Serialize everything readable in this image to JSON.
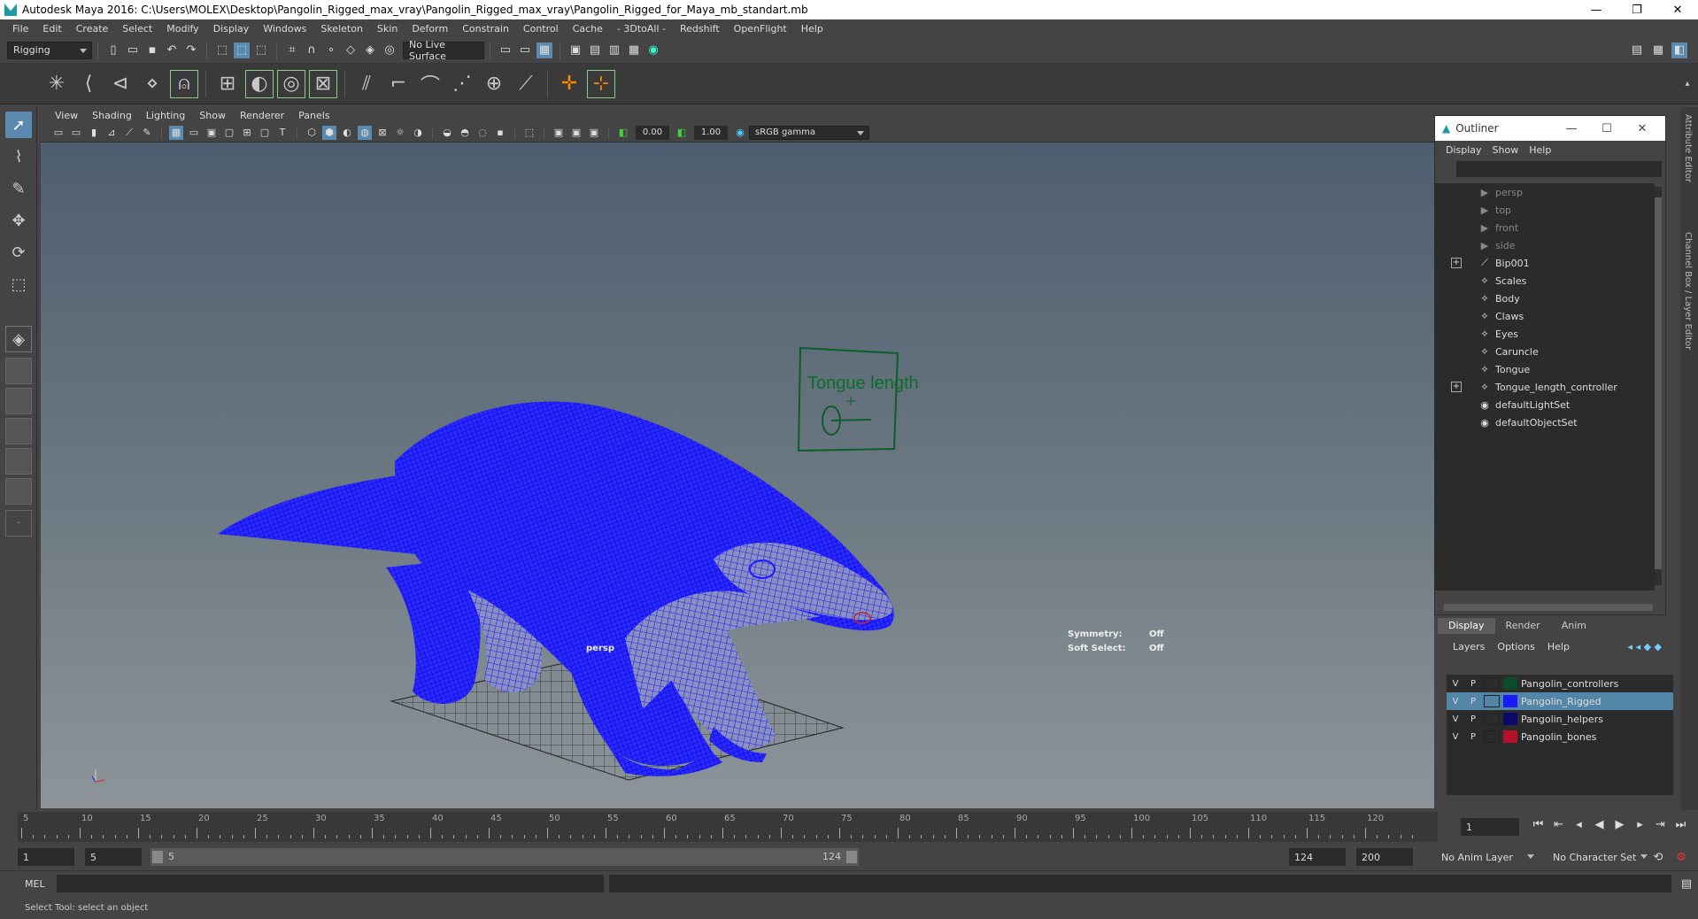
{
  "app": {
    "window_title": "Autodesk Maya 2016: C:\\Users\\MOLEX\\Desktop\\Pangolin_Rigged_max_vray\\Pangolin_Rigged_max_vray\\Pangolin_Rigged_for_Maya_mb_standart.mb",
    "window_controls": [
      "—",
      "❐",
      "✕"
    ]
  },
  "menubar": [
    "File",
    "Edit",
    "Create",
    "Select",
    "Modify",
    "Display",
    "Windows",
    "Skeleton",
    "Skin",
    "Deform",
    "Constrain",
    "Control",
    "Cache",
    "- 3DtoAll -",
    "Redshift",
    "OpenFlight",
    "Help"
  ],
  "statusline": {
    "menuset": "Rigging",
    "live_surface": "No Live Surface"
  },
  "viewport": {
    "menu": [
      "View",
      "Shading",
      "Lighting",
      "Show",
      "Renderer",
      "Panels"
    ],
    "toolbar": {
      "exposure": "0.00",
      "gamma": "1.00",
      "color_space": "sRGB gamma"
    },
    "camera_label": "persp",
    "hud": {
      "symmetry_label": "Symmetry:",
      "symmetry_value": "Off",
      "soft_select_label": "Soft Select:",
      "soft_select_value": "Off"
    },
    "controller_label": "Tongue length",
    "mesh_color": "#1a1aff",
    "controller_color": "#0b5d2a"
  },
  "outliner": {
    "title": "Outliner",
    "menu": [
      "Display",
      "Show",
      "Help"
    ],
    "items": [
      {
        "label": "persp",
        "icon": "camera-icon",
        "dim": true,
        "expandable": false
      },
      {
        "label": "top",
        "icon": "camera-icon",
        "dim": true,
        "expandable": false
      },
      {
        "label": "front",
        "icon": "camera-icon",
        "dim": true,
        "expandable": false
      },
      {
        "label": "side",
        "icon": "camera-icon",
        "dim": true,
        "expandable": false
      },
      {
        "label": "Bip001",
        "icon": "joint-icon",
        "dim": false,
        "expandable": true
      },
      {
        "label": "Scales",
        "icon": "transform-icon",
        "dim": false,
        "expandable": false
      },
      {
        "label": "Body",
        "icon": "transform-icon",
        "dim": false,
        "expandable": false
      },
      {
        "label": "Claws",
        "icon": "transform-icon",
        "dim": false,
        "expandable": false
      },
      {
        "label": "Eyes",
        "icon": "transform-icon",
        "dim": false,
        "expandable": false
      },
      {
        "label": "Caruncle",
        "icon": "transform-icon",
        "dim": false,
        "expandable": false
      },
      {
        "label": "Tongue",
        "icon": "transform-icon",
        "dim": false,
        "expandable": false
      },
      {
        "label": "Tongue_length_controller",
        "icon": "transform-icon",
        "dim": false,
        "expandable": true
      },
      {
        "label": "defaultLightSet",
        "icon": "set-icon",
        "dim": false,
        "expandable": false
      },
      {
        "label": "defaultObjectSet",
        "icon": "set-icon",
        "dim": false,
        "expandable": false
      }
    ]
  },
  "layer_editor": {
    "tabs": [
      "Display",
      "Render",
      "Anim"
    ],
    "active_tab": "Display",
    "menu": [
      "Layers",
      "Options",
      "Help"
    ],
    "layers": [
      {
        "v": "V",
        "p": "P",
        "name": "Pangolin_controllers",
        "color": "#0b4a2a",
        "selected": false
      },
      {
        "v": "V",
        "p": "P",
        "name": "Pangolin_Rigged",
        "color": "#1a1aff",
        "selected": true
      },
      {
        "v": "V",
        "p": "P",
        "name": "Pangolin_helpers",
        "color": "#0a0a6a",
        "selected": false
      },
      {
        "v": "V",
        "p": "P",
        "name": "Pangolin_bones",
        "color": "#b5122a",
        "selected": false
      }
    ]
  },
  "side_tabs": [
    "Attribute Editor",
    "Channel Box / Layer Editor"
  ],
  "timeline": {
    "ticks": [
      "5",
      "10",
      "15",
      "20",
      "25",
      "30",
      "35",
      "40",
      "45",
      "50",
      "55",
      "60",
      "65",
      "70",
      "75",
      "80",
      "85",
      "90",
      "95",
      "100",
      "105",
      "110",
      "115",
      "120"
    ],
    "current_frame": "1"
  },
  "range": {
    "start": "1",
    "playback_start": "5",
    "slider_start": "5",
    "slider_end": "124",
    "playback_end": "124",
    "end": "200",
    "anim_layer": "No Anim Layer",
    "character_set": "No Character Set"
  },
  "command_line": {
    "label": "MEL"
  },
  "help_line": "Select Tool: select an object"
}
